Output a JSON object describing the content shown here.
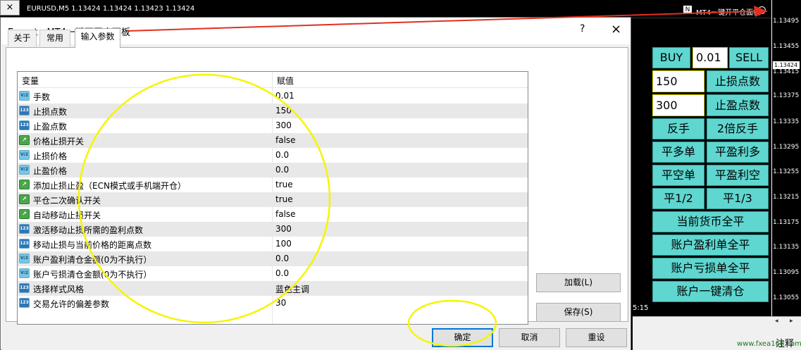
{
  "chart": {
    "close_glyph": "×",
    "symbol_line": "EURUSD,M5  1.13424 1.13424 1.13423 1.13424",
    "panel_title": "MT4一键开平仓面板",
    "panel_logo": "N",
    "price_ticks": [
      "1.13495",
      "1.13455",
      "1.13415",
      "1.13375",
      "1.13335",
      "1.13295",
      "1.13255",
      "1.13215",
      "1.13175",
      "1.13135",
      "1.13095",
      "1.13055"
    ],
    "current_price": "1.13424",
    "time_label": "5:15",
    "scroll_left": "◂",
    "scroll_right": "▸",
    "watermark": "www.fxea168.com",
    "watermark_extra": "注释"
  },
  "trade_panel": {
    "buy": "BUY",
    "lot": "0.01",
    "sell": "SELL",
    "sl_value": "150",
    "sl_label": "止损点数",
    "tp_value": "300",
    "tp_label": "止盈点数",
    "reverse": "反手",
    "double_reverse": "2倍反手",
    "close_long": "平多单",
    "close_long_profit": "平盈利多",
    "close_short": "平空单",
    "close_short_profit": "平盈利空",
    "close_half": "平1/2",
    "close_third": "平1/3",
    "close_symbol_all": "当前货币全平",
    "close_account_profit": "账户盈利单全平",
    "close_account_loss": "账户亏损单全平",
    "close_account_all": "账户一键清仓"
  },
  "dialog": {
    "title": "Expert - MT4一键开平仓面板",
    "help": "?",
    "close": "×",
    "tabs": [
      {
        "label": "关于",
        "active": false
      },
      {
        "label": "常用",
        "active": false
      },
      {
        "label": "输入参数",
        "active": true
      }
    ],
    "columns": {
      "variable": "变量",
      "value": "赋值"
    },
    "params": [
      {
        "icon": "V/2",
        "name": "手数",
        "value": "0.01"
      },
      {
        "icon": "123",
        "name": "止损点数",
        "value": "150"
      },
      {
        "icon": "123",
        "name": "止盈点数",
        "value": "300"
      },
      {
        "icon": "↗",
        "name": "价格止损开关",
        "value": "false"
      },
      {
        "icon": "V/2",
        "name": "止损价格",
        "value": "0.0"
      },
      {
        "icon": "V/2",
        "name": "止盈价格",
        "value": "0.0"
      },
      {
        "icon": "↗",
        "name": "添加止损止盈（ECN模式或手机端开仓）",
        "value": "true"
      },
      {
        "icon": "↗",
        "name": "平仓二次确认开关",
        "value": "true"
      },
      {
        "icon": "↗",
        "name": "自动移动止损开关",
        "value": "false"
      },
      {
        "icon": "123",
        "name": "激活移动止损所需的盈利点数",
        "value": "300"
      },
      {
        "icon": "123",
        "name": "移动止损与当前价格的距离点数",
        "value": "100"
      },
      {
        "icon": "V/2",
        "name": "账户盈利清仓金额(0为不执行）",
        "value": "0.0"
      },
      {
        "icon": "V/2",
        "name": "账户亏损清仓金额(0为不执行）",
        "value": "0.0"
      },
      {
        "icon": "123",
        "name": "选择样式风格",
        "value": "蓝色主调"
      },
      {
        "icon": "123",
        "name": "交易允许的偏差参数",
        "value": "30"
      }
    ],
    "buttons": {
      "load": "加载(L)",
      "save": "保存(S)",
      "ok": "确定",
      "cancel": "取消",
      "reset": "重设"
    }
  },
  "colors": {
    "panel_button": "#5fd7d0",
    "annotation_arrow": "#e03020",
    "annotation_circle": "#f5f500"
  }
}
